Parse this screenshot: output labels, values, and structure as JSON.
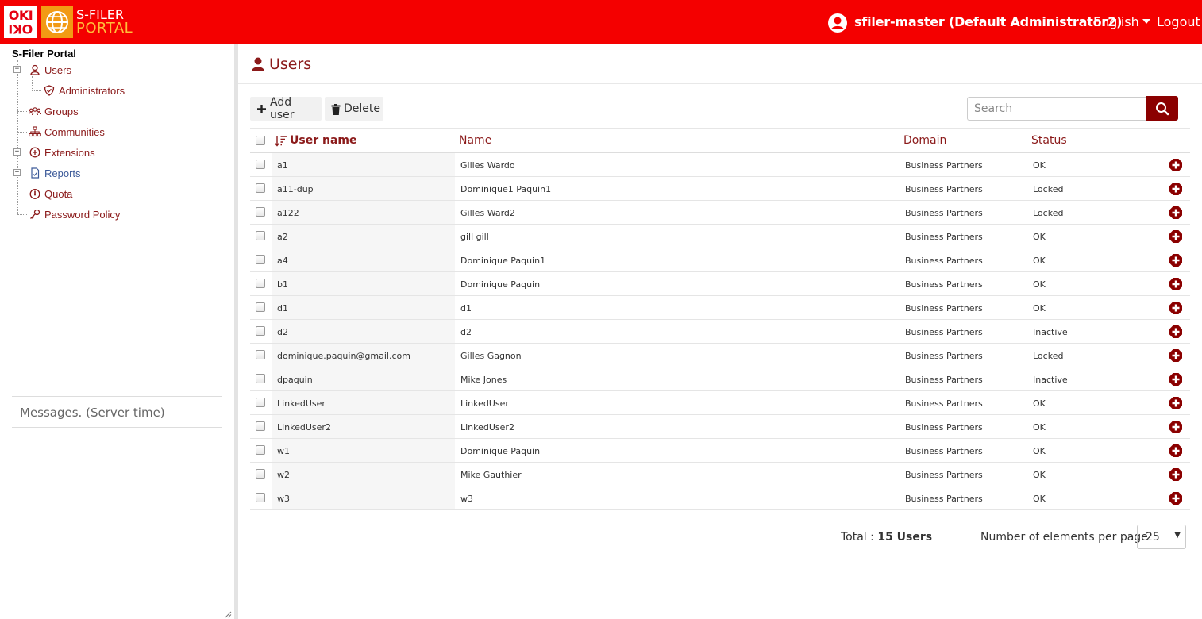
{
  "header": {
    "logo_oki_top": "OKI",
    "logo_oki_bottom": "OKI",
    "product_line1": "S-FILER",
    "product_line2": "PORTAL",
    "user_label": "sfiler-master (Default Administrator2)",
    "language": "English",
    "logout": "Logout",
    "bg_color": "#f40000"
  },
  "sidebar": {
    "root": "S-Filer Portal",
    "items": [
      {
        "label": "Users",
        "icon": "user-outline-icon"
      },
      {
        "label": "Administrators",
        "icon": "shield-check-icon"
      },
      {
        "label": "Groups",
        "icon": "group-icon"
      },
      {
        "label": "Communities",
        "icon": "hierarchy-icon"
      },
      {
        "label": "Extensions",
        "icon": "plus-circle-icon"
      },
      {
        "label": "Reports",
        "icon": "report-icon"
      },
      {
        "label": "Quota",
        "icon": "gauge-icon"
      },
      {
        "label": "Password Policy",
        "icon": "key-icon"
      }
    ],
    "messages": "Messages. (Server time)"
  },
  "main": {
    "title": "Users",
    "add_user": "Add user",
    "delete": "Delete",
    "search_placeholder": "Search",
    "columns": {
      "username": "User name",
      "name": "Name",
      "domain": "Domain",
      "status": "Status"
    },
    "rows": [
      {
        "username": "a1",
        "name": "Gilles Wardo",
        "domain": "Business Partners",
        "status": "OK"
      },
      {
        "username": "a11-dup",
        "name": "Dominique1 Paquin1",
        "domain": "Business Partners",
        "status": "Locked"
      },
      {
        "username": "a122",
        "name": "Gilles Ward2",
        "domain": "Business Partners",
        "status": "Locked"
      },
      {
        "username": "a2",
        "name": "gill gill",
        "domain": "Business Partners",
        "status": "OK"
      },
      {
        "username": "a4",
        "name": "Dominique Paquin1",
        "domain": "Business Partners",
        "status": "OK"
      },
      {
        "username": "b1",
        "name": "Dominique Paquin",
        "domain": "Business Partners",
        "status": "OK"
      },
      {
        "username": "d1",
        "name": "d1",
        "domain": "Business Partners",
        "status": "OK"
      },
      {
        "username": "d2",
        "name": "d2",
        "domain": "Business Partners",
        "status": "Inactive"
      },
      {
        "username": "dominique.paquin@gmail.com",
        "name": "Gilles Gagnon",
        "domain": "Business Partners",
        "status": "Locked"
      },
      {
        "username": "dpaquin",
        "name": "Mike Jones",
        "domain": "Business Partners",
        "status": "Inactive"
      },
      {
        "username": "LinkedUser",
        "name": "LinkedUser",
        "domain": "Business Partners",
        "status": "OK"
      },
      {
        "username": "LinkedUser2",
        "name": "LinkedUser2",
        "domain": "Business Partners",
        "status": "OK"
      },
      {
        "username": "w1",
        "name": "Dominique Paquin",
        "domain": "Business Partners",
        "status": "OK"
      },
      {
        "username": "w2",
        "name": "Mike Gauthier",
        "domain": "Business Partners",
        "status": "OK"
      },
      {
        "username": "w3",
        "name": "w3",
        "domain": "Business Partners",
        "status": "OK"
      }
    ],
    "total_label": "Total : ",
    "total_value": "15 Users",
    "per_page_label": "Number of elements per page",
    "per_page_value": "25"
  }
}
